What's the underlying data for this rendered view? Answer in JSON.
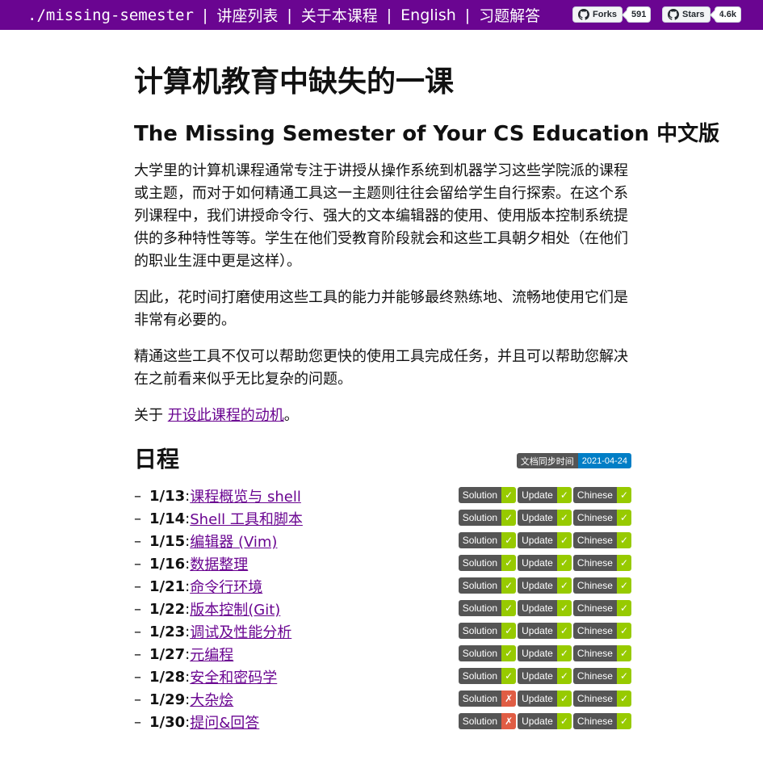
{
  "nav": {
    "brand": "./missing-semester",
    "sep": "|",
    "links": [
      "讲座列表",
      "关于本课程",
      "English",
      "习题解答"
    ],
    "forks": {
      "label": "Forks",
      "count": "591"
    },
    "stars": {
      "label": "Stars",
      "count": "4.6k"
    }
  },
  "page": {
    "title": "计算机教育中缺失的一课",
    "subtitle": "The Missing Semester of Your CS Education 中文版",
    "paragraphs": [
      "大学里的计算机课程通常专注于讲授从操作系统到机器学习这些学院派的课程或主题，而对于如何精通工具这一主题则往往会留给学生自行探索。在这个系列课程中，我们讲授命令行、强大的文本编辑器的使用、使用版本控制系统提供的多种特性等等。学生在他们受教育阶段就会和这些工具朝夕相处（在他们的职业生涯中更是这样）。",
      "因此，花时间打磨使用这些工具的能力并能够最终熟练地、流畅地使用它们是非常有必要的。",
      "精通这些工具不仅可以帮助您更快的使用工具完成任务，并且可以帮助您解决在之前看来似乎无比复杂的问题。"
    ],
    "about_prefix": "关于 ",
    "about_link": "开设此课程的动机",
    "about_suffix": "。"
  },
  "schedule": {
    "heading": "日程",
    "sync_label": "文档同步时间",
    "sync_date": "2021-04-24",
    "badge_labels": {
      "solution": "Solution",
      "update": "Update",
      "chinese": "Chinese"
    },
    "check": "✓",
    "cross": "✗",
    "colors": {
      "ok": "#97ca00",
      "no": "#e05d44",
      "accent": "#6a0591"
    },
    "items": [
      {
        "dash": "–",
        "date": "1/13",
        "sep": ": ",
        "title": "课程概览与 shell",
        "solution": true,
        "update": true,
        "chinese": true
      },
      {
        "dash": "–",
        "date": "1/14",
        "sep": ": ",
        "title": "Shell 工具和脚本",
        "solution": true,
        "update": true,
        "chinese": true
      },
      {
        "dash": "–",
        "date": "1/15",
        "sep": ": ",
        "title": "编辑器 (Vim)",
        "solution": true,
        "update": true,
        "chinese": true
      },
      {
        "dash": "–",
        "date": "1/16",
        "sep": ": ",
        "title": "数据整理",
        "solution": true,
        "update": true,
        "chinese": true
      },
      {
        "dash": "–",
        "date": "1/21",
        "sep": ": ",
        "title": "命令行环境",
        "solution": true,
        "update": true,
        "chinese": true
      },
      {
        "dash": "–",
        "date": "1/22",
        "sep": ": ",
        "title": "版本控制(Git)",
        "solution": true,
        "update": true,
        "chinese": true
      },
      {
        "dash": "–",
        "date": "1/23",
        "sep": ": ",
        "title": "调试及性能分析",
        "solution": true,
        "update": true,
        "chinese": true
      },
      {
        "dash": "–",
        "date": "1/27",
        "sep": ": ",
        "title": "元编程",
        "solution": true,
        "update": true,
        "chinese": true
      },
      {
        "dash": "–",
        "date": "1/28",
        "sep": ": ",
        "title": "安全和密码学",
        "solution": true,
        "update": true,
        "chinese": true
      },
      {
        "dash": "–",
        "date": "1/29",
        "sep": ": ",
        "title": "大杂烩",
        "solution": false,
        "update": true,
        "chinese": true
      },
      {
        "dash": "–",
        "date": "1/30",
        "sep": ": ",
        "title": "提问&回答",
        "solution": false,
        "update": true,
        "chinese": true
      }
    ]
  }
}
